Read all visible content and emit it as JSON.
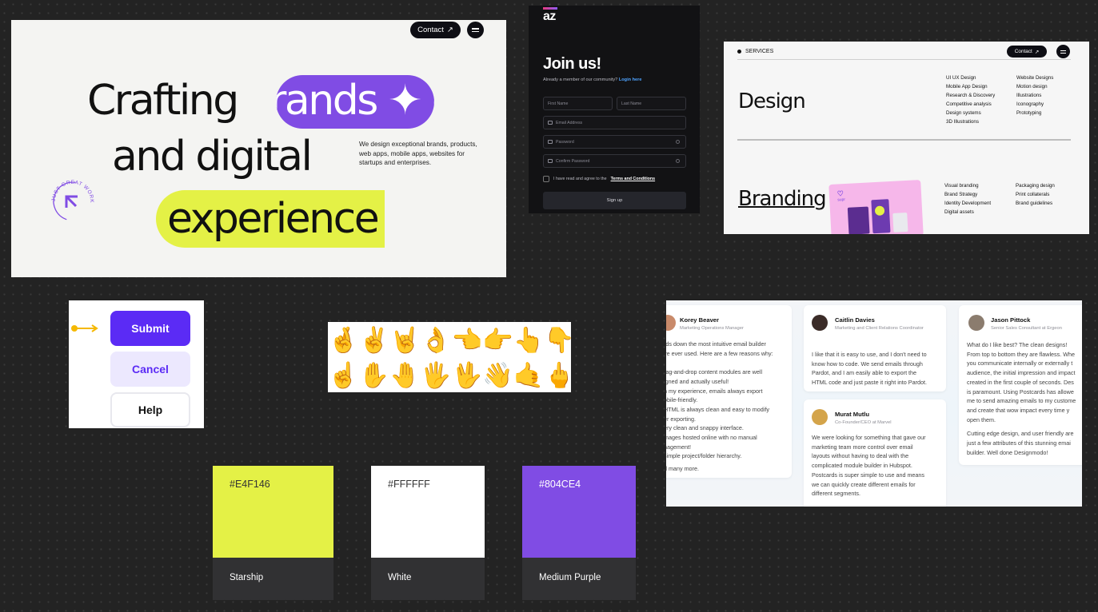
{
  "hero": {
    "contact_label": "Contact",
    "contact_arrow": "↗",
    "line1": "Crafting",
    "pill_purple": "rands ✦ e",
    "line2": "and digital",
    "pill_lime": "experience",
    "description": "We design exceptional brands, products, web apps, mobile apps, websites for startups and enterprises.",
    "badge_text": "JUST GREAT WORK",
    "colors": {
      "purple": "#804CE4",
      "lime": "#E4F146"
    }
  },
  "join": {
    "logo": "az",
    "title": "Join us!",
    "subtitle": "Already a member of our community?",
    "login_link": "Login here",
    "first_name_placeholder": "First Name",
    "last_name_placeholder": "Last Name",
    "email_placeholder": "Email Address",
    "password_placeholder": "Password",
    "confirm_password_placeholder": "Confirm Password",
    "terms_text": "I have read and agree to the",
    "terms_link": "Terms and Conditions",
    "signup_label": "Sign up"
  },
  "services": {
    "label": "SERVICES",
    "contact_label": "Contact",
    "contact_arrow": "↗",
    "design": {
      "title": "Design",
      "col1": [
        "UI UX Design",
        "Mobile App Design",
        "Research & Discovery",
        "Competitive analysis",
        "Design systems",
        "3D Illustrations"
      ],
      "col2": [
        "Website Designs",
        "Motion design",
        "Illustrations",
        "Iconography",
        "Prototyping"
      ]
    },
    "branding": {
      "title": "Branding",
      "col1": [
        "Visual branding",
        "Brand Strategy",
        "Identity Development",
        "Digital assets"
      ],
      "col2": [
        "Packaging design",
        "Print collaterals",
        "Brand guidelines"
      ]
    },
    "image_brand": "supr"
  },
  "buttons": {
    "submit": "Submit",
    "cancel": "Cancel",
    "help": "Help"
  },
  "emoji": {
    "row1": [
      "🤞",
      "✌️",
      "🤘",
      "👌",
      "👈",
      "👉",
      "👆",
      "👇"
    ],
    "row2": [
      "☝️",
      "✋",
      "🤚",
      "🖐️",
      "🖖",
      "👋",
      "🤙",
      "🖕"
    ]
  },
  "testimonials": [
    {
      "name": "Korey Beaver",
      "role": "Marketing Operations Manager",
      "lines": [
        "rds down the most intuitive email builder",
        "ve ever used. Here are a few reasons why:",
        "",
        "rag-and-drop content modules are well",
        "igned and actually useful!",
        "n my experience, emails always export",
        "obile-friendly.",
        "HTML is always clean and easy to modify",
        "er exporting.",
        "ery clean and snappy interface.",
        "mages hosted online with no manual",
        "nagement!",
        "simple project/folder hierarchy.",
        "",
        "d many more."
      ]
    },
    {
      "name": "Caitlin Davies",
      "role": "Marketing and Client Relations Coordinator",
      "lines": [
        "I like that it is easy to use, and I don't need to",
        "know how to code. We send emails through",
        "Pardot, and I am easily able to export the",
        "HTML code and just paste it right into Pardot."
      ]
    },
    {
      "name": "Jason Pittock",
      "role": "Senior Sales Consultant at Ergeon",
      "lines": [
        "What do I like best? The clean designs!",
        "From top to bottom they are flawless. Whe",
        "you communicate internally or externally t",
        "audience, the initial impression and impact",
        "created in the first couple of seconds. Des",
        "is paramount. Using Postcards has allowe",
        "me to send amazing emails to my custome",
        "and create that wow impact every time y",
        "open them.",
        "",
        "Cutting edge design, and user friendly are",
        "just a few attributes of this stunning emai",
        "builder. Well done Designmodo!"
      ]
    },
    {
      "name": "Murat Mutlu",
      "role": "Co-Founder/CEO at Marvel",
      "lines": [
        "We were looking for something that gave our",
        "marketing team more control over email",
        "layouts without having to deal with the",
        "complicated module builder in Hubspot.",
        "Postcards is super simple to use and means",
        "we can quickly create different emails for",
        "different segments."
      ]
    }
  ],
  "swatches": [
    {
      "hex": "#E4F146",
      "name": "Starship",
      "color": "#E4F146",
      "text_color": "#333333"
    },
    {
      "hex": "#FFFFFF",
      "name": "White",
      "color": "#FFFFFF",
      "text_color": "#333333"
    },
    {
      "hex": "#804CE4",
      "name": "Medium Purple",
      "color": "#804CE4",
      "text_color": "#FFFFFF"
    }
  ]
}
